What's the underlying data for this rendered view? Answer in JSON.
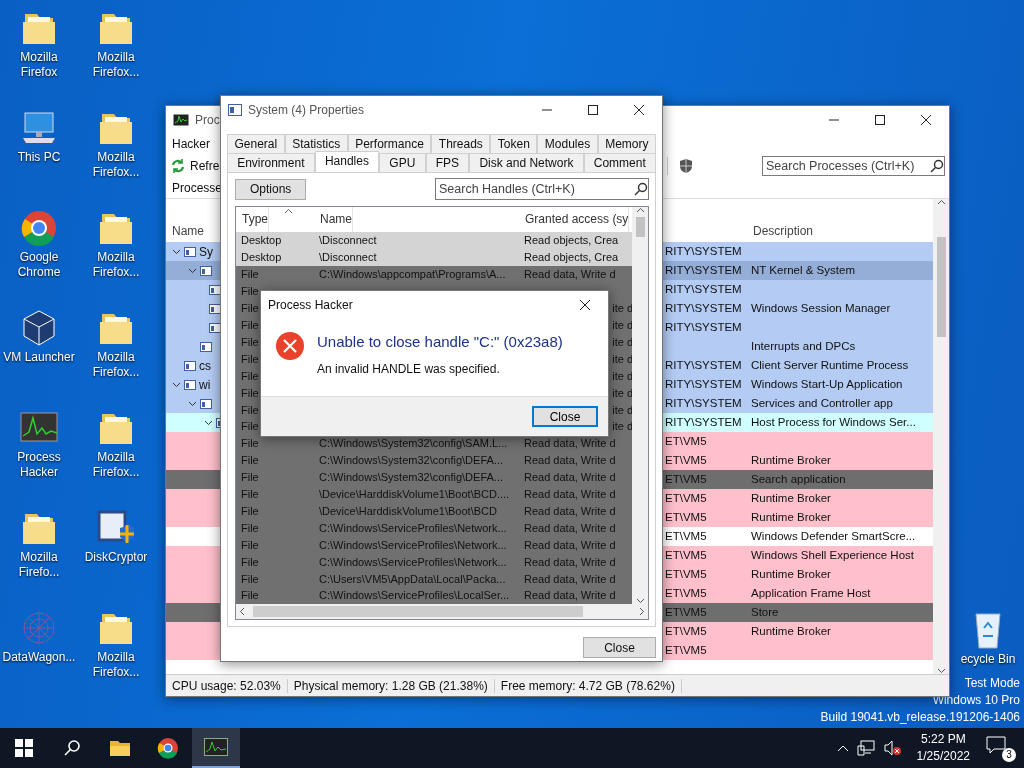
{
  "desktop_icons": [
    {
      "label": "Mozilla Firefox",
      "kind": "folder"
    },
    {
      "label": "This PC",
      "kind": "pc"
    },
    {
      "label": "Google Chrome",
      "kind": "chrome"
    },
    {
      "label": "VM Launcher",
      "kind": "vbox"
    },
    {
      "label": "Process Hacker",
      "kind": "monitor"
    },
    {
      "label": "Mozilla Firefo...",
      "kind": "folder"
    },
    {
      "label": "DataWagon...",
      "kind": "wagon"
    },
    {
      "label": "Mozilla Firefox...",
      "kind": "folder"
    },
    {
      "label": "Mozilla Firefox...",
      "kind": "folder"
    },
    {
      "label": "Mozilla Firefox...",
      "kind": "folder"
    },
    {
      "label": "Mozilla Firefox...",
      "kind": "folder"
    },
    {
      "label": "Mozilla Firefox...",
      "kind": "folder"
    },
    {
      "label": "DiskCryptor",
      "kind": "disk"
    },
    {
      "label": "Mozilla Firefox...",
      "kind": "folder"
    }
  ],
  "recycle_bin": {
    "label": "ecycle Bin"
  },
  "watermark": [
    "Test Mode",
    "Windows 10 Pro",
    "Build 19041.vb_release.191206-1406"
  ],
  "main_window": {
    "title": "Proc",
    "menu": [
      "Hacker"
    ],
    "refresh_label": "Refre",
    "search": {
      "placeholder": "Search Processes (Ctrl+K)"
    },
    "tab": "Processe",
    "columns": [
      "Name",
      "Description"
    ],
    "processes": [
      {
        "name": "Sy",
        "user": "RITY\\SYSTEM",
        "color": "#b4ccf4",
        "expanded": true,
        "children": [
          {
            "user": "RITY\\SYSTEM",
            "description": "NT Kernel & System",
            "color": "#94aed8",
            "expanded": true,
            "children": [
              {
                "user": "RITY\\SYSTEM",
                "color": "#b4ccf4"
              },
              {
                "user": "RITY\\SYSTEM",
                "description": "Windows Session Manager",
                "color": "#b4ccf4"
              },
              {
                "user": "RITY\\SYSTEM",
                "color": "#b4ccf4"
              }
            ]
          },
          {
            "description": "Interrupts and DPCs",
            "color": "#b4ccf4"
          }
        ]
      },
      {
        "name": "cs",
        "user": "RITY\\SYSTEM",
        "description": "Client Server Runtime Process",
        "color": "#b4ccf4"
      },
      {
        "name": "wi",
        "user": "RITY\\SYSTEM",
        "description": "Windows Start-Up Application",
        "color": "#b4ccf4",
        "expanded": true,
        "children": [
          {
            "user": "RITY\\SYSTEM",
            "description": "Services and Controller app",
            "color": "#b4ccf4",
            "expanded": true,
            "children": [
              {
                "user": "RITY\\SYSTEM",
                "description": "Host Process for Windows Ser...",
                "color": "#d0ffff",
                "expanded": true,
                "children": [
                  {
                    "user": "ET\\VM5",
                    "color": "#ffc0cb"
                  },
                  {
                    "user": "ET\\VM5",
                    "description": "Runtime Broker",
                    "color": "#ffc0cb"
                  },
                  {
                    "user": "ET\\VM5",
                    "description": "Search application",
                    "color": "#6e6e6e"
                  },
                  {
                    "user": "ET\\VM5",
                    "description": "Runtime Broker",
                    "color": "#ffc0cb"
                  },
                  {
                    "user": "ET\\VM5",
                    "description": "Runtime Broker",
                    "color": "#ffc0cb"
                  },
                  {
                    "user": "ET\\VM5",
                    "description": "Windows Defender SmartScre...",
                    "color": "#ffffff"
                  },
                  {
                    "user": "ET\\VM5",
                    "description": "Windows Shell Experience Host",
                    "color": "#ffc0cb"
                  },
                  {
                    "user": "ET\\VM5",
                    "description": "Runtime Broker",
                    "color": "#ffc0cb"
                  },
                  {
                    "user": "ET\\VM5",
                    "description": "Application Frame Host",
                    "color": "#ffc0cb"
                  },
                  {
                    "user": "ET\\VM5",
                    "description": "Store",
                    "color": "#6e6e6e"
                  },
                  {
                    "user": "ET\\VM5",
                    "description": "Runtime Broker",
                    "color": "#ffc0cb"
                  },
                  {
                    "user": "ET\\VM5",
                    "color": "#ffc0cb"
                  }
                ]
              }
            ]
          }
        ]
      }
    ],
    "status_bar": [
      "CPU usage: 52.03%",
      "Physical memory: 1.28 GB (21.38%)",
      "Free memory: 4.72 GB (78.62%)"
    ]
  },
  "properties_window": {
    "title": "System (4) Properties",
    "tab_rows": [
      {
        "tabs": [
          {
            "label": "General",
            "selected": false
          },
          {
            "label": "Statistics",
            "selected": false
          },
          {
            "label": "Performance",
            "selected": false
          },
          {
            "label": "Threads",
            "selected": false
          },
          {
            "label": "Token",
            "selected": false
          },
          {
            "label": "Modules",
            "selected": false
          },
          {
            "label": "Memory",
            "selected": false
          }
        ]
      },
      {
        "tabs": [
          {
            "label": "Environment",
            "selected": false
          },
          {
            "label": "Handles",
            "selected": true
          },
          {
            "label": "GPU",
            "selected": false
          },
          {
            "label": "FPS",
            "selected": false
          },
          {
            "label": "Disk and Network",
            "selected": false
          },
          {
            "label": "Comment",
            "selected": false
          }
        ]
      }
    ],
    "options_button": "Options",
    "search": {
      "placeholder": "Search Handles (Ctrl+K)"
    },
    "columns": [
      "Type",
      "Name",
      "Granted access (sy"
    ],
    "handles": [
      {
        "type": "Desktop",
        "name": "\\Disconnect",
        "access": "Read objects, Crea",
        "color": "#d4d4d4"
      },
      {
        "type": "Desktop",
        "name": "\\Disconnect",
        "access": "Read objects, Crea",
        "color": "#d4d4d4"
      },
      {
        "type": "File",
        "name": "C:\\Windows\\appcompat\\Programs\\A...",
        "access": "Read data, Write d",
        "color": "#707070"
      },
      {
        "type": "File",
        "color": "#707070"
      },
      {
        "type": "File",
        "access": "ite d",
        "color": "#707070"
      },
      {
        "type": "File",
        "access": "ite d",
        "color": "#707070"
      },
      {
        "type": "File",
        "access": "ite d",
        "color": "#707070"
      },
      {
        "type": "File",
        "access": "ite d",
        "color": "#707070"
      },
      {
        "type": "File",
        "access": "ite d",
        "color": "#707070"
      },
      {
        "type": "File",
        "access": "ite d",
        "color": "#707070"
      },
      {
        "type": "File",
        "access": "ite d",
        "color": "#707070"
      },
      {
        "type": "File",
        "access": "ite d",
        "color": "#707070"
      },
      {
        "type": "File",
        "name": "C:\\Windows\\System32\\config\\SAM.L...",
        "access": "Read data, Write d",
        "color": "#707070"
      },
      {
        "type": "File",
        "name": "C:\\Windows\\System32\\config\\DEFA...",
        "access": "Read data, Write d",
        "color": "#707070"
      },
      {
        "type": "File",
        "name": "C:\\Windows\\System32\\config\\DEFA...",
        "access": "Read data, Write d",
        "color": "#707070"
      },
      {
        "type": "File",
        "name": "\\Device\\HarddiskVolume1\\Boot\\BCD....",
        "access": "Read data, Write d",
        "color": "#707070"
      },
      {
        "type": "File",
        "name": "\\Device\\HarddiskVolume1\\Boot\\BCD",
        "access": "Read data, Write d",
        "color": "#707070"
      },
      {
        "type": "File",
        "name": "C:\\Windows\\ServiceProfiles\\Network...",
        "access": "Read data, Write d",
        "color": "#707070"
      },
      {
        "type": "File",
        "name": "C:\\Windows\\ServiceProfiles\\Network...",
        "access": "Read data, Write d",
        "color": "#707070"
      },
      {
        "type": "File",
        "name": "C:\\Windows\\ServiceProfiles\\Network...",
        "access": "Read data, Write d",
        "color": "#707070"
      },
      {
        "type": "File",
        "name": "C:\\Users\\VM5\\AppData\\Local\\Packa...",
        "access": "Read data, Write d",
        "color": "#707070"
      },
      {
        "type": "File",
        "name": "C:\\Windows\\ServiceProfiles\\LocalSer...",
        "access": "Read data, Write d",
        "color": "#707070"
      }
    ],
    "close_button": "Close"
  },
  "dialog": {
    "title": "Process Hacker",
    "heading": "Unable to close handle \"C:\" (0x23a8)",
    "message": "An invalid HANDLE was specified.",
    "button": "Close"
  },
  "taskbar": {
    "items": [
      {
        "kind": "start",
        "selected": false
      },
      {
        "kind": "search",
        "selected": false
      },
      {
        "kind": "explorer",
        "selected": false
      },
      {
        "kind": "chrome",
        "selected": false
      },
      {
        "kind": "monitor",
        "selected": true
      }
    ],
    "time": "5:22 PM",
    "date": "1/25/2022",
    "notifications": "3"
  }
}
